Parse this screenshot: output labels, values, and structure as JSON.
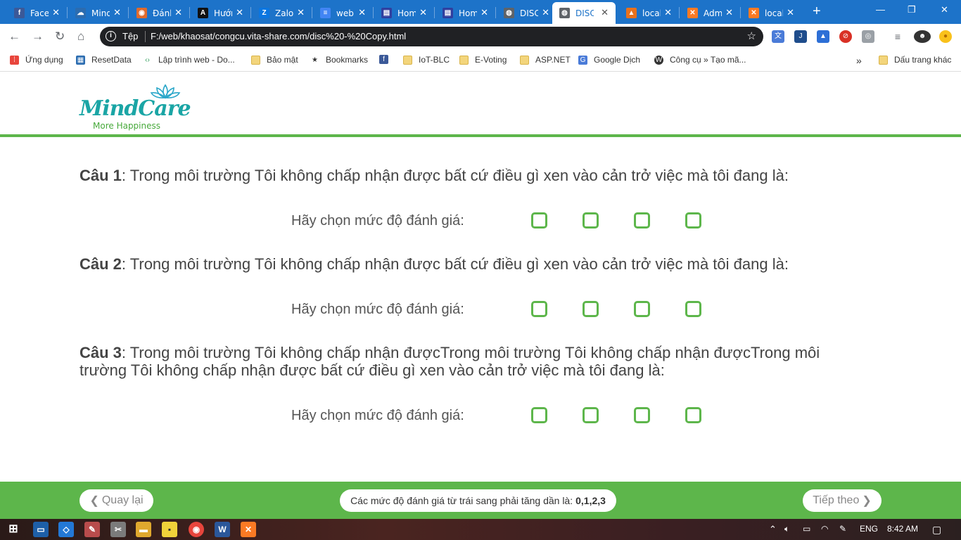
{
  "browser": {
    "tabs": [
      {
        "label": "Facebook",
        "icon": "facebook-icon",
        "color": "#3b5998",
        "glyph": "f"
      },
      {
        "label": "Mind",
        "icon": "cloud-icon",
        "color": "#2b6cb0",
        "glyph": "☁"
      },
      {
        "label": "Đánh",
        "icon": "circle-icon",
        "color": "#e06a2c",
        "glyph": "◉"
      },
      {
        "label": "Hướng",
        "icon": "letter-a-icon",
        "color": "#111111",
        "glyph": "A"
      },
      {
        "label": "Zalo",
        "icon": "zalo-icon",
        "color": "#0b76e0",
        "glyph": "Z"
      },
      {
        "label": "web",
        "icon": "doc-icon",
        "color": "#4285f4",
        "glyph": "≡"
      },
      {
        "label": "Home",
        "icon": "page-icon",
        "color": "#303f9f",
        "glyph": "▤"
      },
      {
        "label": "Home",
        "icon": "page-icon",
        "color": "#303f9f",
        "glyph": "▤"
      },
      {
        "label": "DISC",
        "icon": "globe-icon",
        "color": "#5f6368",
        "glyph": "◍"
      },
      {
        "label": "DISC",
        "icon": "globe-icon",
        "color": "#5f6368",
        "glyph": "◍"
      },
      {
        "label": "local",
        "icon": "xampp-icon",
        "color": "#e8711c",
        "glyph": "▲"
      },
      {
        "label": "Adm",
        "icon": "xampp-icon",
        "color": "#fb7a24",
        "glyph": "✕"
      },
      {
        "label": "local",
        "icon": "xampp-icon",
        "color": "#fb7a24",
        "glyph": "✕"
      }
    ],
    "new_tab": "+",
    "address": {
      "scheme_label": "Tệp",
      "url": "F:/web/khaosat/congcu.vita-share.com/disc%20-%20Copy.html"
    },
    "bookmarks": [
      {
        "label": "Ứng dụng",
        "icon": "apps-grid-icon"
      },
      {
        "label": "ResetData",
        "icon": "resetdata-icon"
      },
      {
        "label": "Lập trình web - Do...",
        "icon": "code-icon"
      },
      {
        "label": "Bảo mật",
        "icon": "folder-icon"
      },
      {
        "label": "Bookmarks",
        "icon": "star-icon"
      },
      {
        "label": "",
        "icon": "facebook-icon"
      },
      {
        "label": "IoT-BLC",
        "icon": "folder-icon"
      },
      {
        "label": "E-Voting",
        "icon": "folder-icon"
      },
      {
        "label": "ASP.NET",
        "icon": "folder-icon"
      },
      {
        "label": "Google Dịch",
        "icon": "translate-icon"
      },
      {
        "label": "Công cụ » Tạo mã...",
        "icon": "wordpress-icon"
      }
    ],
    "bookmarks_overflow": "»",
    "other_bookmarks": "Dấu trang khác"
  },
  "site": {
    "logo": {
      "mind": "Mind",
      "care": "Care",
      "tagline": "More Happiness"
    }
  },
  "questions": [
    {
      "num": "Câu 1",
      "text": ": Trong môi trường Tôi không chấp nhận được bất cứ điều gì xen vào cản trở việc mà tôi đang là:",
      "rate_label": "Hãy chọn mức độ đánh giá:"
    },
    {
      "num": "Câu 2",
      "text": ": Trong môi trường Tôi không chấp nhận được bất cứ điều gì xen vào cản trở việc mà tôi đang là:",
      "rate_label": "Hãy chọn mức độ đánh giá:"
    },
    {
      "num": "Câu 3",
      "text": ": Trong môi trường Tôi không chấp nhận đượcTrong môi trường Tôi không chấp nhận đượcTrong môi trường Tôi không chấp nhận được bất cứ điều gì xen vào cản trở việc mà tôi đang là:",
      "rate_label": "Hãy chọn mức độ đánh giá:"
    }
  ],
  "footer": {
    "back_label": "Quay lại",
    "hint_text": "Các mức độ đánh giá từ trái sang phải tăng dần là:",
    "hint_values": "0,1,2,3",
    "next_label": "Tiếp theo"
  },
  "taskbar": {
    "language": "ENG",
    "time": "8:42 AM"
  },
  "colors": {
    "brand_green": "#5db64b",
    "chrome_blue": "#1d73c9"
  }
}
